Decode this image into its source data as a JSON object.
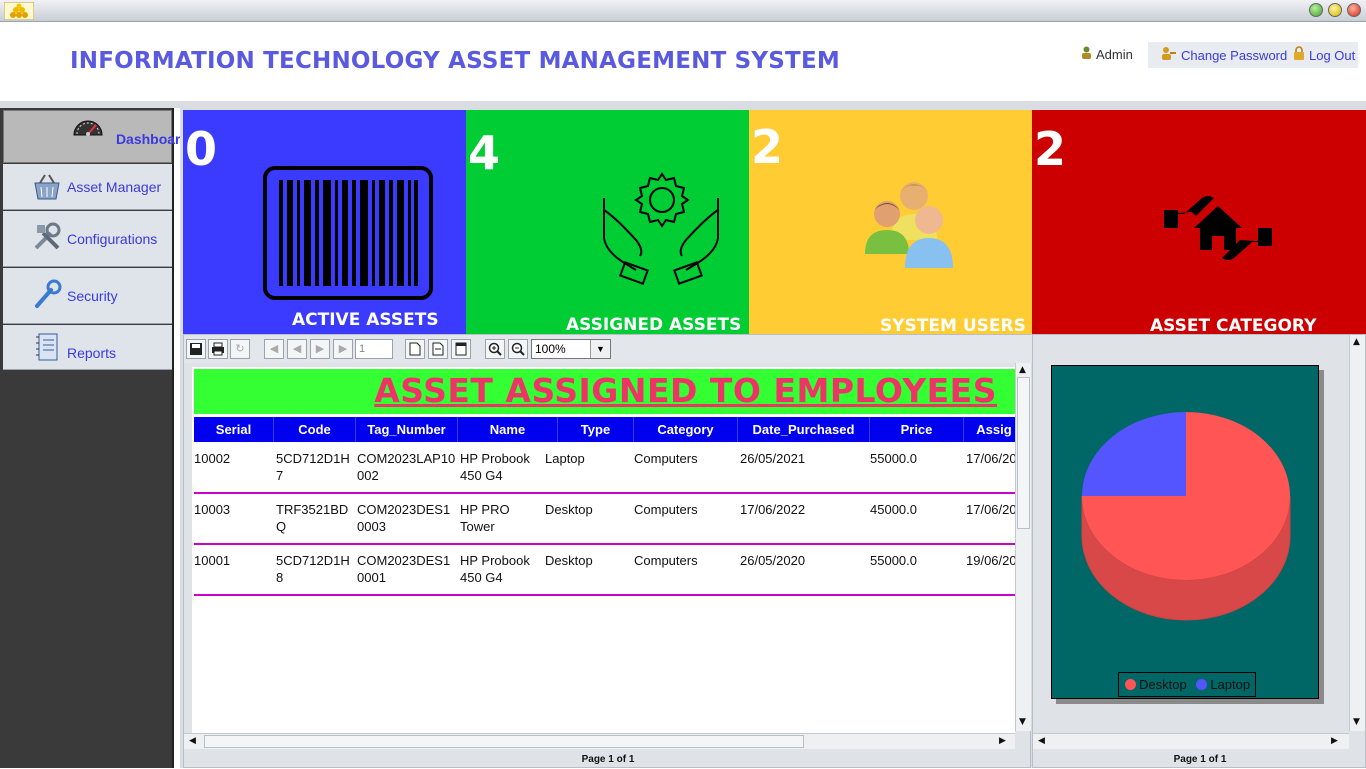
{
  "header": {
    "title": "INFORMATION TECHNOLOGY ASSET MANAGEMENT SYSTEM",
    "admin_label": "Admin",
    "change_password_label": "Change Password",
    "logout_label": "Log Out"
  },
  "sidebar": {
    "items": [
      {
        "label": "Dashboard",
        "icon": "gauge-icon"
      },
      {
        "label": "Asset Manager",
        "icon": "basket-icon"
      },
      {
        "label": "Configurations",
        "icon": "tools-icon"
      },
      {
        "label": "Security",
        "icon": "wrench-icon"
      },
      {
        "label": "Reports",
        "icon": "notebook-icon"
      }
    ]
  },
  "tiles": [
    {
      "value": "0",
      "label": "ACTIVE ASSETS",
      "color": "#3b3bff",
      "icon": "barcode-icon"
    },
    {
      "value": "4",
      "label": "ASSIGNED ASSETS",
      "color": "#00cc33",
      "icon": "hands-gear-icon"
    },
    {
      "value": "2",
      "label": "SYSTEM USERS",
      "color": "#ffcc33",
      "icon": "users-icon"
    },
    {
      "value": "2",
      "label": "ASSET CATEGORY",
      "color": "#cc0000",
      "icon": "home-hands-icon"
    }
  ],
  "report": {
    "zoom": "100%",
    "page_input": "1",
    "title": "ASSET ASSIGNED TO EMPLOYEES",
    "columns": [
      "Serial",
      "Code",
      "Tag_Number",
      "Name",
      "Type",
      "Category",
      "Date_Purchased",
      "Price",
      "Assig"
    ],
    "rows": [
      {
        "serial": "10002",
        "code_1": "5CD712D1H",
        "code_2": "7",
        "tag_1": "COM2023LAP10",
        "tag_2": "002",
        "name_1": "HP Probook",
        "name_2": "450 G4",
        "type": "Laptop",
        "category": "Computers",
        "date": "26/05/2021",
        "price": "55000.0",
        "assigned": "17/06/20"
      },
      {
        "serial": "10003",
        "code_1": "TRF3521BD",
        "code_2": "Q",
        "tag_1": "COM2023DES1",
        "tag_2": "0003",
        "name_1": "HP PRO",
        "name_2": "Tower",
        "type": "Desktop",
        "category": "Computers",
        "date": "17/06/2022",
        "price": "45000.0",
        "assigned": "17/06/20"
      },
      {
        "serial": "10001",
        "code_1": "5CD712D1H",
        "code_2": "8",
        "tag_1": "COM2023DES1",
        "tag_2": "0001",
        "name_1": "HP Probook",
        "name_2": "450 G4",
        "type": "Desktop",
        "category": "Computers",
        "date": "26/05/2020",
        "price": "55000.0",
        "assigned": "19/06/20"
      }
    ],
    "status": "Page 1 of 1"
  },
  "chart_data": {
    "type": "pie",
    "categories": [
      "Desktop",
      "Laptop"
    ],
    "values": [
      75,
      25
    ],
    "colors": [
      "#ff5555",
      "#5555ff"
    ],
    "legend": "bottom",
    "status": "Page 1 of 1"
  }
}
